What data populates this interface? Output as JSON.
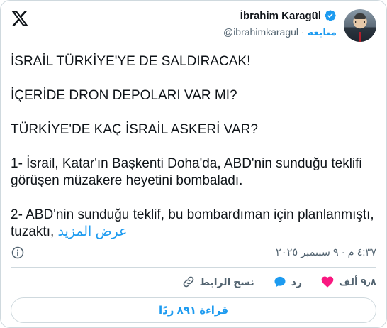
{
  "header": {
    "author_name": "İbrahim Karagül",
    "handle": "@ibrahimkaragul",
    "follow_label": "متابعة",
    "icons": [
      "x-logo-icon",
      "verified-badge-icon",
      "avatar"
    ]
  },
  "tweet": {
    "paragraphs": [
      "İSRAİL TÜRKİYE'YE DE SALDIRACAK!",
      "İÇERİDE DRON DEPOLARI VAR MI?",
      "TÜRKİYE'DE KAÇ İSRAİL ASKERİ VAR?",
      "1- İsrail, Katar'ın Başkenti Doha'da, ABD'nin sunduğu teklifi görüşen müzakere heyetini bombaladı.",
      "2- ABD'nin sunduğu teklif, bu bombardıman için planlanmıştı, tuzaktı,"
    ],
    "show_more": "عرض المزيد"
  },
  "meta": {
    "timestamp": "٤:٣٧ م · ٩ سبتمبر ٢٠٢٥"
  },
  "actions": {
    "likes_count": "٩٫٨ ألف",
    "reply_label": "رد",
    "copy_link_label": "نسخ الرابط"
  },
  "footer": {
    "read_replies": "قراءة ٨٩١ ردًا"
  },
  "colors": {
    "accent": "#1d9bf0",
    "like": "#f91880",
    "muted": "#536471",
    "border": "#cfd9de"
  }
}
